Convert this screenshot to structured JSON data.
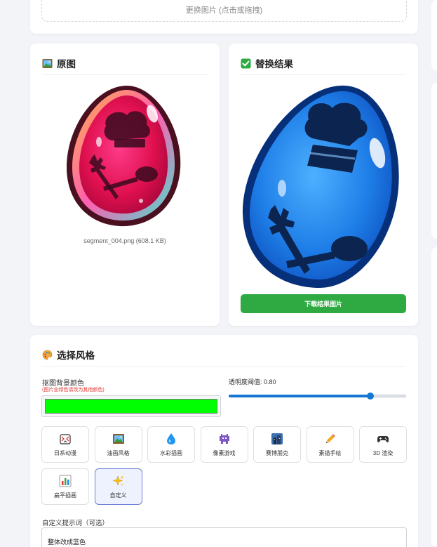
{
  "upload": {
    "label": "更换图片 (点击或拖拽)"
  },
  "original": {
    "title": "原图",
    "icon": "picture-icon",
    "filename": "segment_004.png (608.1 KB)"
  },
  "result": {
    "title": "替换结果",
    "icon": "checkmark-icon",
    "download_label": "下载结果图片"
  },
  "style_section": {
    "title": "选择风格",
    "icon": "palette-icon",
    "bg_color_label": "抠图背景颜色",
    "bg_color_hint": "(图片含绿色请改为其他颜色)",
    "bg_color_value": "#00ff00",
    "threshold_label": "透明度阈值: 0.80",
    "threshold_value": 0.8,
    "styles": [
      {
        "label": "日系动漫",
        "icon": "anime-icon"
      },
      {
        "label": "油画风格",
        "icon": "framed-picture-icon"
      },
      {
        "label": "水彩插画",
        "icon": "water-drop-icon"
      },
      {
        "label": "像素游戏",
        "icon": "pixel-invader-icon"
      },
      {
        "label": "赛博朋克",
        "icon": "city-building-icon"
      },
      {
        "label": "素描手绘",
        "icon": "pencil-icon"
      },
      {
        "label": "3D 渲染",
        "icon": "gamepad-icon"
      },
      {
        "label": "扁平插画",
        "icon": "bar-chart-icon"
      },
      {
        "label": "自定义",
        "icon": "sparkles-icon"
      }
    ],
    "selected_style": "自定义",
    "custom_prompt_label": "自定义提示词（可选）",
    "custom_prompt_value": "整体改成蓝色"
  },
  "colors": {
    "accent_blue": "#1677d2",
    "download_green": "#2faa43",
    "hint_red": "#e53935",
    "swatch_green": "#00ff00"
  }
}
